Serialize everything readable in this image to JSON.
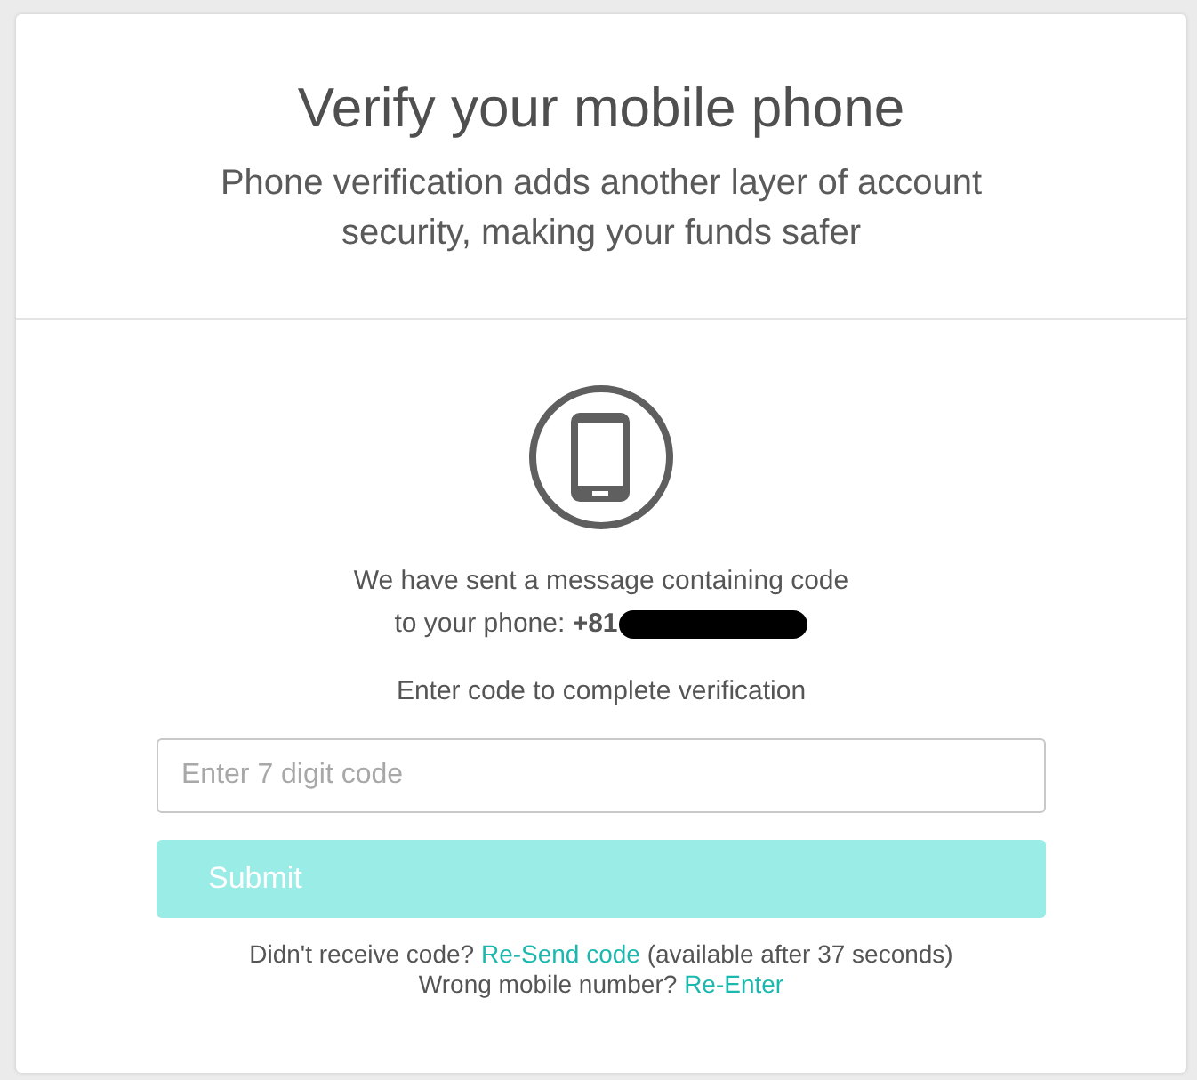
{
  "header": {
    "title": "Verify your mobile phone",
    "subtitle": "Phone verification adds another layer of account security, making your funds safer"
  },
  "message": {
    "line_1": "We have sent a message containing code",
    "line_2": "to your phone: **+81**",
    "redacted": true
  },
  "instruction": "Enter code to complete verification",
  "code_field": {
    "placeholder": "Enter 7 digit code"
  },
  "submit_button": {
    "label": "Submit",
    "disabled": true
  },
  "resend_note": {
    "before": "Didn't receive code?",
    "link": "Re-Send code",
    "after": "(available after 37 seconds)"
  },
  "reenter_note": {
    "before": "Wrong mobile number?",
    "link": "Re-Enter"
  }
}
